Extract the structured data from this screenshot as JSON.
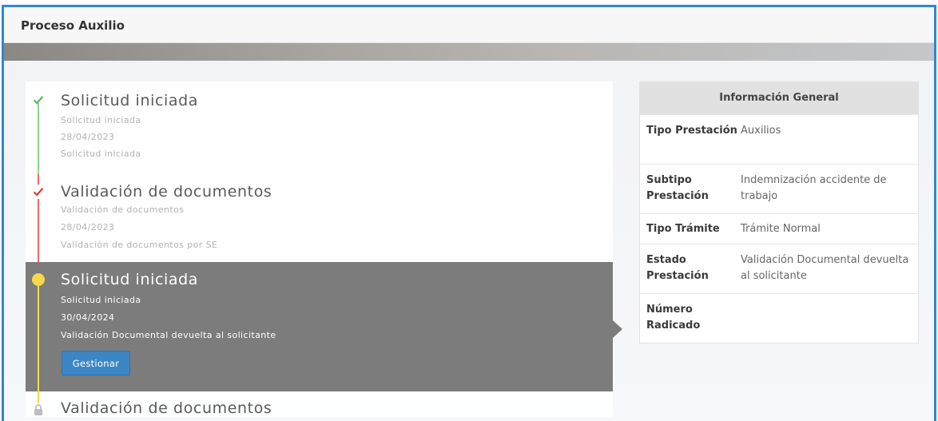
{
  "header": {
    "title": "Proceso Auxilio"
  },
  "timeline": {
    "steps": [
      {
        "title": "Solicitud iniciada",
        "detail": "Solicitud iniciada",
        "date": "28/04/2023",
        "status": "Solicitud iniciada",
        "state": "completed",
        "color": "#5cb85c"
      },
      {
        "title": "Validación de documentos",
        "detail": "Validación de documentos",
        "date": "28/04/2023",
        "status": "Validación de documentos por SE",
        "state": "rejected",
        "color": "#e53935"
      },
      {
        "title": "Solicitud iniciada",
        "detail": "Solicitud iniciada",
        "date": "30/04/2024",
        "status": "Validación Documental devuelta al solicitante",
        "state": "current",
        "color": "#f7d84a",
        "action_label": "Gestionar"
      },
      {
        "title": "Validación de documentos",
        "state": "locked",
        "color": "#c8c8c8"
      }
    ]
  },
  "info": {
    "heading": "Información General",
    "rows": [
      {
        "label": "Tipo Prestación",
        "value": "Auxilios"
      },
      {
        "label": "Subtipo Prestación",
        "value": "Indemnización accidente de trabajo"
      },
      {
        "label": "Tipo Trámite",
        "value": "Trámite Normal"
      },
      {
        "label": "Estado Prestación",
        "value": "Validación Documental devuelta al solicitante"
      },
      {
        "label": "Número Radicado",
        "value": ""
      }
    ]
  },
  "icons": {
    "step1": "check-icon",
    "step2": "check-icon",
    "step3": "current-dot-icon",
    "step4": "lock-icon"
  }
}
